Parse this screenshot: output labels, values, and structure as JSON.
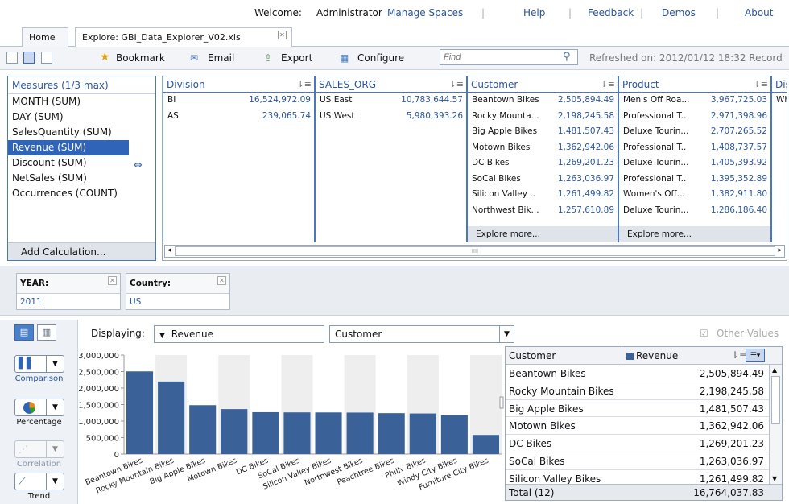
{
  "top": {
    "welcome": "Welcome:",
    "user": "Administrator",
    "links": [
      "Manage Spaces",
      "Help",
      "Feedback",
      "Demos",
      "About"
    ]
  },
  "tabs": {
    "home": "Home",
    "explore": "Explore: GBI_Data_Explorer_V02.xls"
  },
  "toolbar": {
    "bookmark": "Bookmark",
    "email": "Email",
    "export": "Export",
    "configure": "Configure",
    "find_placeholder": "Find",
    "refreshed": "Refreshed on: 2012/01/12 18:32 Record"
  },
  "measures": {
    "title": "Measures (1/3 max)",
    "items": [
      "MONTH (SUM)",
      "DAY (SUM)",
      "SalesQuantity (SUM)",
      "Revenue (SUM)",
      "Discount (SUM)",
      "NetSales (SUM)",
      "Occurrences (COUNT)"
    ],
    "selected": "Revenue (SUM)",
    "add_calc": "Add Calculation..."
  },
  "dimensions": [
    {
      "name": "Division",
      "rows": [
        [
          "BI",
          "16,524,972.09"
        ],
        [
          "AS",
          "239,065.74"
        ]
      ],
      "more": ""
    },
    {
      "name": "SALES_ORG",
      "rows": [
        [
          "US East",
          "10,783,644.57"
        ],
        [
          "US West",
          "5,980,393.26"
        ]
      ],
      "more": ""
    },
    {
      "name": "Customer",
      "rows": [
        [
          "Beantown Bikes",
          "2,505,894.49"
        ],
        [
          "Rocky Mounta...",
          "2,198,245.58"
        ],
        [
          "Big Apple Bikes",
          "1,481,507.43"
        ],
        [
          "Motown Bikes",
          "1,362,942.06"
        ],
        [
          "DC Bikes",
          "1,269,201.23"
        ],
        [
          "SoCal Bikes",
          "1,263,036.97"
        ],
        [
          "Silicon Valley ..",
          "1,261,499.82"
        ],
        [
          "Northwest Bik...",
          "1,257,610.89"
        ]
      ],
      "more": "Explore more..."
    },
    {
      "name": "Product",
      "rows": [
        [
          "Men's Off Roa...",
          "3,967,725.03"
        ],
        [
          "Professional T..",
          "2,971,398.96"
        ],
        [
          "Deluxe Tourin...",
          "2,707,265.52"
        ],
        [
          "Professional T..",
          "1,408,737.57"
        ],
        [
          "Deluxe Tourin...",
          "1,405,393.92"
        ],
        [
          "Professional T..",
          "1,395,352.89"
        ],
        [
          "Women's Off...",
          "1,382,911.80"
        ],
        [
          "Deluxe Tourin...",
          "1,286,186.40"
        ]
      ],
      "more": "Explore more..."
    },
    {
      "name": "Dis",
      "rows": [
        [
          "Wh",
          ""
        ]
      ],
      "more": ""
    }
  ],
  "hscroll_grip": "IIII",
  "filters": [
    {
      "label": "YEAR:",
      "value": "2011"
    },
    {
      "label": "Country:",
      "value": "US"
    }
  ],
  "viz": {
    "comparison": "Comparison",
    "percentage": "Percentage",
    "correlation": "Correlation",
    "trend": "Trend"
  },
  "chart_controls": {
    "displaying": "Displaying:",
    "measure": "Revenue",
    "dimension": "Customer",
    "other_values": "Other Values"
  },
  "colors": {
    "bar": "#3a6298",
    "accent": "#2f64b8",
    "link": "#2a55a0"
  },
  "chart_data": {
    "type": "bar",
    "categories": [
      "Beantown Bikes",
      "Rocky Mountain Bikes",
      "Big Apple Bikes",
      "Motown Bikes",
      "DC Bikes",
      "SoCal Bikes",
      "Silicon Valley Bikes",
      "Northwest Bikes",
      "Peachtree Bikes",
      "Philly Bikes",
      "Windy City Bikes",
      "Furniture City Bikes"
    ],
    "values": [
      2505894.49,
      2198245.58,
      1481507.43,
      1362942.06,
      1269201.23,
      1263036.97,
      1261499.82,
      1257610.89,
      1240000,
      1230000,
      1180000,
      580000
    ],
    "yticks": [
      "3,000,000",
      "2,500,000",
      "2,000,000",
      "1,500,000",
      "1,000,000",
      "500,000",
      "0"
    ],
    "ylim": [
      0,
      3000000
    ],
    "grid": false,
    "title": "",
    "xlabel": "",
    "ylabel": ""
  },
  "table": {
    "col1": "Customer",
    "col2": "Revenue",
    "rows": [
      [
        "Beantown Bikes",
        "2,505,894.49"
      ],
      [
        "Rocky Mountain Bikes",
        "2,198,245.58"
      ],
      [
        "Big Apple Bikes",
        "1,481,507.43"
      ],
      [
        "Motown Bikes",
        "1,362,942.06"
      ],
      [
        "DC Bikes",
        "1,269,201.23"
      ],
      [
        "SoCal Bikes",
        "1,263,036.97"
      ],
      [
        "Silicon Valley Bikes",
        "1,261,499.82"
      ]
    ],
    "total_label": "Total (12)",
    "total_value": "16,764,037.83"
  }
}
